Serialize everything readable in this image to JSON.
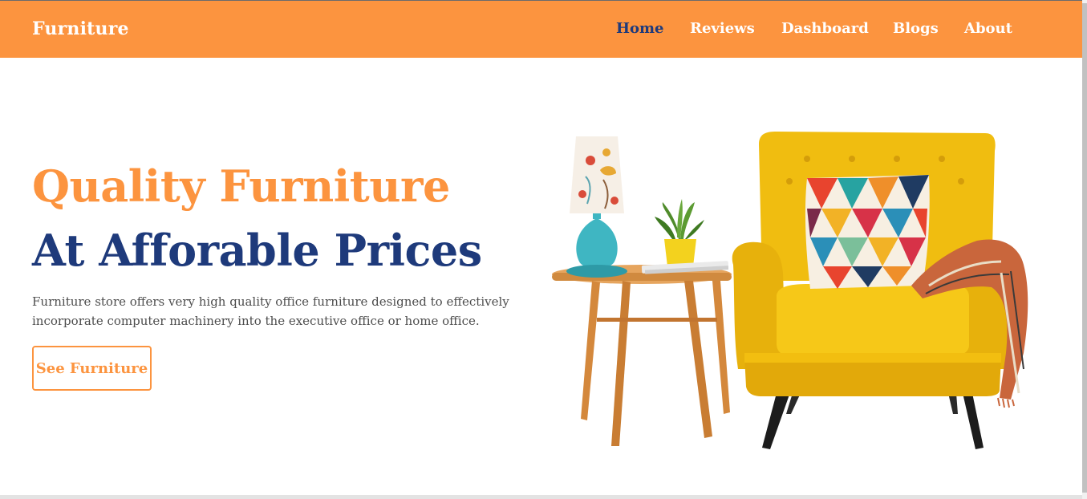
{
  "navbar": {
    "brand": "Furniture",
    "links": [
      {
        "label": "Home",
        "active": true
      },
      {
        "label": "Reviews",
        "active": false
      },
      {
        "label": "Dashboard",
        "active": false
      },
      {
        "label": "Blogs",
        "active": false
      },
      {
        "label": "About",
        "active": false
      }
    ]
  },
  "hero": {
    "title_line1": "Quality Furniture",
    "title_line2": "At Afforable Prices",
    "description": "Furniture store offers very high quality office furniture designed to effectively incorporate computer machinery into the executive office or home office.",
    "cta_label": "See Furniture",
    "image_subject": "yellow armchair with side table, lamp and plant"
  },
  "colors": {
    "accent": "#fc943f",
    "navy": "#1e3a7b",
    "text": "#4d4d4d",
    "chair": "#f2c20f"
  }
}
